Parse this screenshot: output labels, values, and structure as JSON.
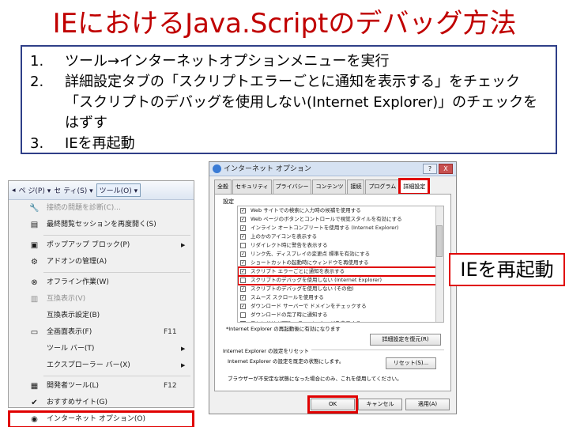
{
  "title": "IEにおけるJava.Scriptのデバッグ方法",
  "steps": [
    {
      "num": "1.",
      "text": "ツール→インターネットオプションメニューを実行"
    },
    {
      "num": "2.",
      "text": "詳細設定タブの「スクリプトエラーごとに通知を表示する」をチェック"
    },
    {
      "num": "",
      "text": "「スクリプトのデバッグを使用しない(Internet Explorer)」のチェックを"
    },
    {
      "num": "",
      "text": "はずす"
    },
    {
      "num": "3.",
      "text": "IEを再起動"
    }
  ],
  "tools_menu": {
    "bar": [
      "ペ ジ(P) ▾",
      "セ ティ(S) ▾",
      "ツール(O) ▾"
    ],
    "items": [
      {
        "label": "接続の問題を診断(C)...",
        "icon": "wrench-icon",
        "dim": true,
        "shortcut": "",
        "arrow": false
      },
      {
        "label": "最終閲覧セッションを再度開く(S)",
        "icon": "page-icon",
        "dim": false,
        "shortcut": "",
        "arrow": false
      },
      {
        "sep": true
      },
      {
        "label": "ポップアップ ブロック(P)",
        "icon": "popup-icon",
        "dim": false,
        "shortcut": "",
        "arrow": true
      },
      {
        "label": "アドオンの管理(A)",
        "icon": "addon-icon",
        "dim": false,
        "shortcut": "",
        "arrow": false
      },
      {
        "sep": true
      },
      {
        "label": "オフライン作業(W)",
        "icon": "offline-icon",
        "dim": false,
        "shortcut": "",
        "arrow": false
      },
      {
        "label": "互換表示(V)",
        "icon": "compat-icon",
        "dim": true,
        "shortcut": "",
        "arrow": false
      },
      {
        "label": "互換表示設定(B)",
        "icon": "blank-icon",
        "dim": false,
        "shortcut": "",
        "arrow": false
      },
      {
        "label": "全画面表示(F)",
        "icon": "fullscreen-icon",
        "dim": false,
        "shortcut": "F11",
        "arrow": false
      },
      {
        "label": "ツール バー(T)",
        "icon": "blank-icon",
        "dim": false,
        "shortcut": "",
        "arrow": true
      },
      {
        "label": "エクスプローラー バー(X)",
        "icon": "blank-icon",
        "dim": false,
        "shortcut": "",
        "arrow": true
      },
      {
        "sep": true
      },
      {
        "label": "開発者ツール(L)",
        "icon": "devtools-icon",
        "dim": false,
        "shortcut": "F12",
        "arrow": false
      },
      {
        "label": "おすすめサイト(G)",
        "icon": "check-icon",
        "dim": false,
        "shortcut": "",
        "arrow": false
      },
      {
        "label": "インターネット オプション(O)",
        "icon": "options-icon",
        "dim": false,
        "shortcut": "",
        "arrow": false,
        "selected": true
      }
    ]
  },
  "dialog": {
    "title": "インターネット オプション",
    "controls": [
      "?",
      "X"
    ],
    "tabs": [
      "全般",
      "セキュリティ",
      "プライバシー",
      "コンテンツ",
      "接続",
      "プログラム",
      "詳細設定"
    ],
    "active_tab": "詳細設定",
    "settings_label": "設定",
    "settings": [
      {
        "checked": true,
        "text": "Web サイトでの検索に入力時の候補を使用する",
        "highlight": false
      },
      {
        "checked": true,
        "text": "Web ページのボタンとコントロールで視覚スタイルを有効にする",
        "highlight": false
      },
      {
        "checked": true,
        "text": "インライン オートコンプリートを使用する (Internet Explorer)",
        "highlight": false
      },
      {
        "checked": true,
        "text": "上のかのアイコンを表示する",
        "highlight": false
      },
      {
        "checked": false,
        "text": "リダイレクト時に警告を表示する",
        "highlight": false
      },
      {
        "checked": true,
        "text": "リンク先、ディスプレイの変更点 標準を有効にする",
        "highlight": false
      },
      {
        "checked": true,
        "text": "ショートカットの起動時にウィンドウを再使用する",
        "highlight": false
      },
      {
        "checked": true,
        "text": "スクリプト エラーごとに通知を表示する",
        "highlight": true
      },
      {
        "checked": false,
        "text": "スクリプトのデバッグを使用しない (Internet Explorer)",
        "highlight": true
      },
      {
        "checked": true,
        "text": "スクリプトのデバッグを使用しない (その他)",
        "highlight": false
      },
      {
        "checked": true,
        "text": "スムーズ スクロールを使用する",
        "highlight": false
      },
      {
        "checked": true,
        "text": "ダウンロード サーバーで ドメインをチェックする",
        "highlight": false
      },
      {
        "checked": false,
        "text": "ダウンロードの完了時に通知する",
        "highlight": false
      },
      {
        "checked": true,
        "text": "フレンドリ HTTP エラー メッセージを表示する",
        "highlight": false
      }
    ],
    "restart_note": "*Internet Explorer の再起動後に有効になります",
    "restore_button": "詳細設定を復元(R)",
    "reset_label": "Internet Explorer の設定をリセット",
    "reset_desc": "Internet Explorer の設定を既定の状態にします。",
    "reset_desc2": "ブラウザーが不安定な状態になった場合にのみ、これを使用してください。",
    "reset_button": "リセット(S)...",
    "ok": "OK",
    "cancel": "キャンセル",
    "apply": "適用(A)"
  },
  "callout": "IEを再起動"
}
